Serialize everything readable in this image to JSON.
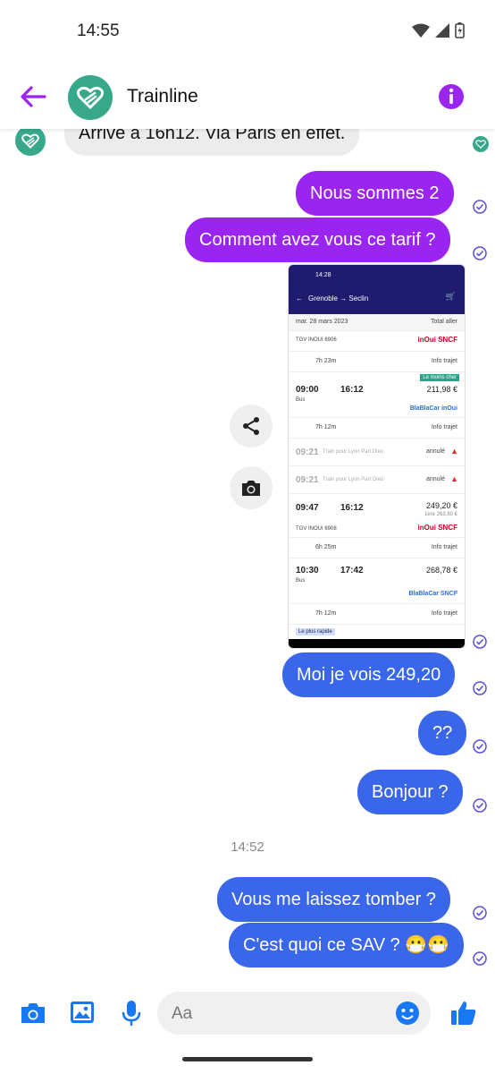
{
  "status": {
    "time": "14:55"
  },
  "header": {
    "title": "Trainline"
  },
  "messages": [
    {
      "text": "Arrive à 16h12. Via Paris en effet.",
      "type": "received"
    },
    {
      "text": "Nous sommes 2",
      "type": "sent"
    },
    {
      "text": "Comment avez vous ce tarif ?",
      "type": "sent"
    },
    {
      "text": "Moi je vois 249,20",
      "type": "sent"
    },
    {
      "text": "??",
      "type": "sent"
    },
    {
      "text": "Bonjour ?",
      "type": "sent"
    },
    {
      "text": "Vous me laissez tomber ?",
      "type": "sent"
    },
    {
      "text": "C'est quoi ce SAV ? 😷😷",
      "type": "sent"
    }
  ],
  "timestamp": "14:52",
  "composer": {
    "placeholder": "Aa"
  },
  "screenshot": {
    "time": "14:28",
    "route": "Grenoble → Seclin",
    "date": "mar. 28 mars 2023",
    "total_label": "Total aller",
    "badge_cheapest": "Le moins cher",
    "badge_fastest": "Le plus rapide",
    "info": "Info trajet",
    "rows": [
      {
        "train": "TGV INOUI 6906",
        "duration": "7h 23m"
      },
      {
        "dep": "09:00",
        "arr": "16:12",
        "price": "211,98 €",
        "sub": "Bus",
        "duration": "7h 12m"
      },
      {
        "dep": "09:21",
        "text": "Train pour Lyon Part Dieu",
        "status": "annulé"
      },
      {
        "dep": "09:21",
        "text": "Train pour Lyon Part Dieu",
        "status": "annulé"
      },
      {
        "dep": "09:47",
        "arr": "16:12",
        "price": "249,20 €",
        "old": "1ère 263,80 €",
        "train": "TGV INOUI 6908",
        "duration": "6h 25m"
      },
      {
        "dep": "10:30",
        "arr": "17:42",
        "price": "268,78 €",
        "sub": "Bus",
        "duration": "7h 12m"
      }
    ]
  }
}
